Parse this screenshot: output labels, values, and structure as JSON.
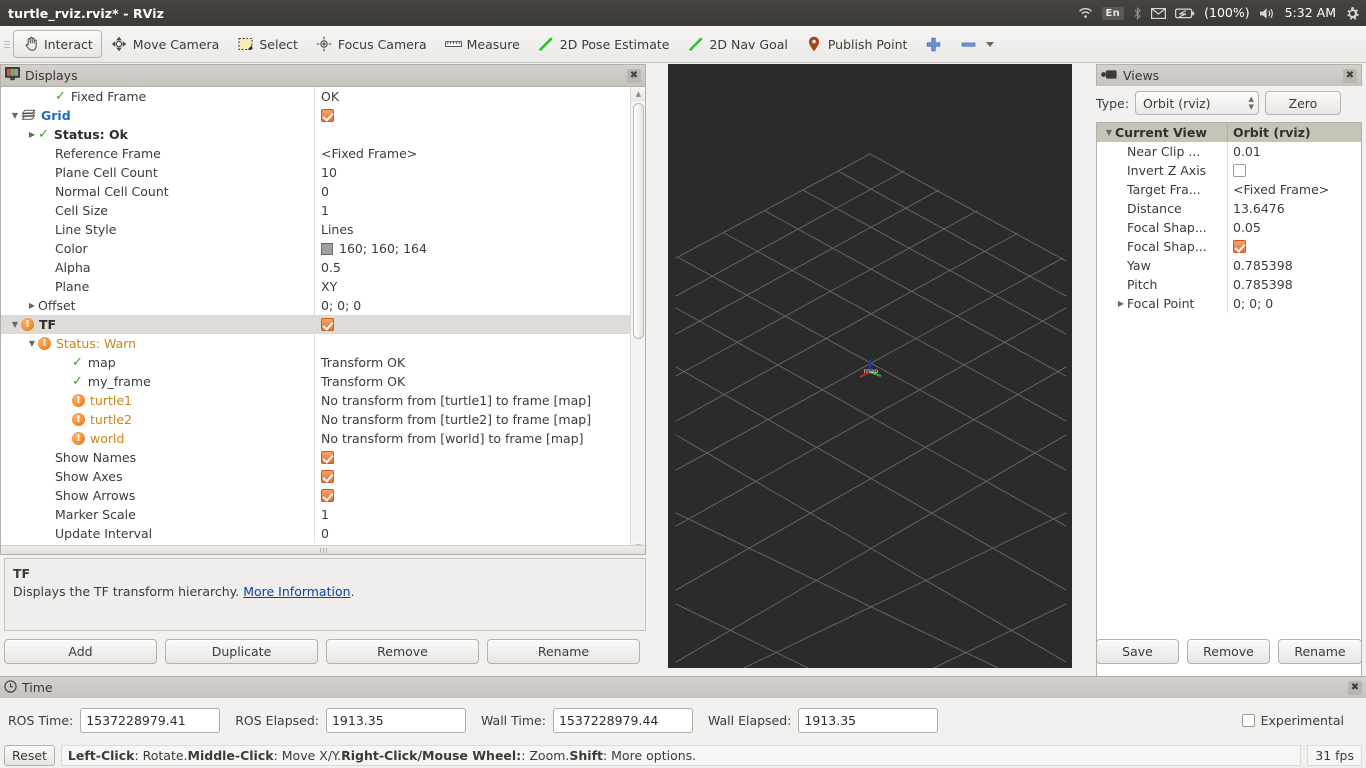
{
  "window": {
    "title": "turtle_rviz.rviz* - RViz"
  },
  "tray": {
    "wifi_icon": "wifi-icon",
    "keyboard_label": "En",
    "bluetooth_icon": "bluetooth-icon",
    "mail_icon": "mail-icon",
    "battery_icon": "battery-icon",
    "battery_label": "(100%)",
    "volume_icon": "volume-icon",
    "clock": "5:32 AM",
    "session_icon": "gear-icon"
  },
  "toolbar": {
    "items": [
      {
        "label": "Interact",
        "icon": "hand-cursor-icon",
        "active": true
      },
      {
        "label": "Move Camera",
        "icon": "move-camera-icon",
        "active": false
      },
      {
        "label": "Select",
        "icon": "select-rect-icon",
        "active": false
      },
      {
        "label": "Focus Camera",
        "icon": "focus-camera-icon",
        "active": false
      },
      {
        "label": "Measure",
        "icon": "ruler-icon",
        "active": false
      },
      {
        "label": "2D Pose Estimate",
        "icon": "pose-arrow-icon",
        "active": false
      },
      {
        "label": "2D Nav Goal",
        "icon": "nav-goal-arrow-icon",
        "active": false
      },
      {
        "label": "Publish Point",
        "icon": "map-pin-icon",
        "active": false
      }
    ],
    "add_tool_icon": "plus-icon",
    "remove_tool_icon": "minus-icon"
  },
  "displays": {
    "title": "Displays",
    "title_icon": "displays-monitor-icon",
    "close_icon": "close-icon",
    "rows": [
      {
        "indent": 2,
        "arrow": "none",
        "status": "ok",
        "name": "Fixed Frame",
        "name_style": "plain",
        "value": "OK",
        "value_type": "text"
      },
      {
        "indent": 0,
        "arrow": "down",
        "status": "grid",
        "name": "Grid",
        "name_style": "link",
        "value": "checked",
        "value_type": "checkbox"
      },
      {
        "indent": 1,
        "arrow": "right",
        "status": "ok",
        "name": "Status: Ok",
        "name_style": "bold",
        "value": "",
        "value_type": "text"
      },
      {
        "indent": 2,
        "arrow": "none",
        "status": "none",
        "name": "Reference Frame",
        "name_style": "plain",
        "value": "<Fixed Frame>",
        "value_type": "text"
      },
      {
        "indent": 2,
        "arrow": "none",
        "status": "none",
        "name": "Plane Cell Count",
        "name_style": "plain",
        "value": "10",
        "value_type": "text"
      },
      {
        "indent": 2,
        "arrow": "none",
        "status": "none",
        "name": "Normal Cell Count",
        "name_style": "plain",
        "value": "0",
        "value_type": "text"
      },
      {
        "indent": 2,
        "arrow": "none",
        "status": "none",
        "name": "Cell Size",
        "name_style": "plain",
        "value": "1",
        "value_type": "text"
      },
      {
        "indent": 2,
        "arrow": "none",
        "status": "none",
        "name": "Line Style",
        "name_style": "plain",
        "value": "Lines",
        "value_type": "text"
      },
      {
        "indent": 2,
        "arrow": "none",
        "status": "none",
        "name": "Color",
        "name_style": "plain",
        "value": "160; 160; 164",
        "value_type": "color",
        "swatch": "#a0a0a4"
      },
      {
        "indent": 2,
        "arrow": "none",
        "status": "none",
        "name": "Alpha",
        "name_style": "plain",
        "value": "0.5",
        "value_type": "text"
      },
      {
        "indent": 2,
        "arrow": "none",
        "status": "none",
        "name": "Plane",
        "name_style": "plain",
        "value": "XY",
        "value_type": "text"
      },
      {
        "indent": 1,
        "arrow": "right",
        "status": "none",
        "name": "Offset",
        "name_style": "plain",
        "value": "0; 0; 0",
        "value_type": "text"
      },
      {
        "indent": 0,
        "arrow": "down",
        "status": "warn",
        "name": "TF",
        "name_style": "bold",
        "value": "checked",
        "value_type": "checkbox",
        "selected": true
      },
      {
        "indent": 1,
        "arrow": "down",
        "status": "warn",
        "name": "Status: Warn",
        "name_style": "warn",
        "value": "",
        "value_type": "text"
      },
      {
        "indent": 3,
        "arrow": "none",
        "status": "ok",
        "name": "map",
        "name_style": "plain",
        "value": "Transform OK",
        "value_type": "text"
      },
      {
        "indent": 3,
        "arrow": "none",
        "status": "ok",
        "name": "my_frame",
        "name_style": "plain",
        "value": "Transform OK",
        "value_type": "text"
      },
      {
        "indent": 3,
        "arrow": "none",
        "status": "warn",
        "name": "turtle1",
        "name_style": "warn",
        "value": "No transform from [turtle1] to frame [map]",
        "value_type": "text"
      },
      {
        "indent": 3,
        "arrow": "none",
        "status": "warn",
        "name": "turtle2",
        "name_style": "warn",
        "value": "No transform from [turtle2] to frame [map]",
        "value_type": "text"
      },
      {
        "indent": 3,
        "arrow": "none",
        "status": "warn",
        "name": "world",
        "name_style": "warn",
        "value": "No transform from [world] to frame [map]",
        "value_type": "text"
      },
      {
        "indent": 2,
        "arrow": "none",
        "status": "none",
        "name": "Show Names",
        "name_style": "plain",
        "value": "checked",
        "value_type": "checkbox"
      },
      {
        "indent": 2,
        "arrow": "none",
        "status": "none",
        "name": "Show Axes",
        "name_style": "plain",
        "value": "checked",
        "value_type": "checkbox"
      },
      {
        "indent": 2,
        "arrow": "none",
        "status": "none",
        "name": "Show Arrows",
        "name_style": "plain",
        "value": "checked",
        "value_type": "checkbox"
      },
      {
        "indent": 2,
        "arrow": "none",
        "status": "none",
        "name": "Marker Scale",
        "name_style": "plain",
        "value": "1",
        "value_type": "text"
      },
      {
        "indent": 2,
        "arrow": "none",
        "status": "none",
        "name": "Update Interval",
        "name_style": "plain",
        "value": "0",
        "value_type": "text"
      }
    ],
    "description": {
      "title": "TF",
      "text_before": "Displays the TF transform hierarchy. ",
      "link": "More Information",
      "text_after": "."
    },
    "buttons": [
      "Add",
      "Duplicate",
      "Remove",
      "Rename"
    ]
  },
  "views": {
    "title": "Views",
    "title_icon": "camera-icon",
    "close_icon": "close-icon",
    "type_label": "Type:",
    "type_value": "Orbit (rviz)",
    "zero_button": "Zero",
    "header": {
      "name": "Current View",
      "value": "Orbit (rviz)"
    },
    "rows": [
      {
        "name": "Near Clip ...",
        "value": "0.01",
        "type": "text",
        "arrow": "none"
      },
      {
        "name": "Invert Z Axis",
        "value": "unchecked",
        "type": "checkbox",
        "arrow": "none"
      },
      {
        "name": "Target Fra...",
        "value": "<Fixed Frame>",
        "type": "text",
        "arrow": "none"
      },
      {
        "name": "Distance",
        "value": "13.6476",
        "type": "text",
        "arrow": "none"
      },
      {
        "name": "Focal Shap...",
        "value": "0.05",
        "type": "text",
        "arrow": "none"
      },
      {
        "name": "Focal Shap...",
        "value": "checked",
        "type": "checkbox",
        "arrow": "none"
      },
      {
        "name": "Yaw",
        "value": "0.785398",
        "type": "text",
        "arrow": "none"
      },
      {
        "name": "Pitch",
        "value": "0.785398",
        "type": "text",
        "arrow": "none"
      },
      {
        "name": "Focal Point",
        "value": "0; 0; 0",
        "type": "text",
        "arrow": "right"
      }
    ],
    "buttons": [
      "Save",
      "Remove",
      "Rename"
    ]
  },
  "viewport": {
    "origin_label": "map",
    "background_color": "#2b2b2b",
    "grid_color": "#a0a0a4",
    "axis_x_color": "#cc2222",
    "axis_y_color": "#22aa22",
    "axis_z_color": "#2233cc"
  },
  "time": {
    "title": "Time",
    "title_icon": "clock-icon",
    "close_icon": "close-icon",
    "fields": [
      {
        "label": "ROS Time:",
        "value": "1537228979.41"
      },
      {
        "label": "ROS Elapsed:",
        "value": "1913.35"
      },
      {
        "label": "Wall Time:",
        "value": "1537228979.44"
      },
      {
        "label": "Wall Elapsed:",
        "value": "1913.35"
      }
    ],
    "experimental_label": "Experimental",
    "experimental_checked": false
  },
  "statusbar": {
    "reset_button": "Reset",
    "hint_parts": [
      {
        "text": "Left-Click",
        "bold": true
      },
      {
        "text": ": Rotate. ",
        "bold": false
      },
      {
        "text": "Middle-Click",
        "bold": true
      },
      {
        "text": ": Move X/Y. ",
        "bold": false
      },
      {
        "text": "Right-Click/Mouse Wheel:",
        "bold": true
      },
      {
        "text": ": Zoom. ",
        "bold": false
      },
      {
        "text": "Shift",
        "bold": true
      },
      {
        "text": ": More options.",
        "bold": false
      }
    ],
    "fps": "31 fps"
  }
}
